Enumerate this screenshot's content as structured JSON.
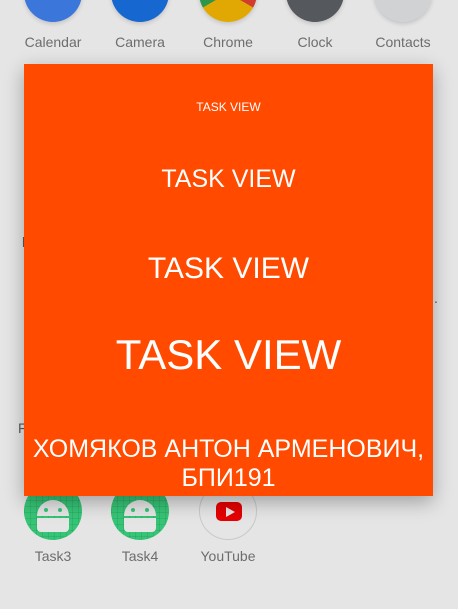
{
  "launcher": {
    "top_row": [
      {
        "label": "Calendar",
        "icon": "calendar-icon",
        "color": "#4285f4"
      },
      {
        "label": "Camera",
        "icon": "camera-icon",
        "color": "#1a73e8"
      },
      {
        "label": "Chrome",
        "icon": "chrome-icon",
        "color": "#fbbc04"
      },
      {
        "label": "Clock",
        "icon": "clock-icon",
        "color": "#5f6368"
      },
      {
        "label": "Contacts",
        "icon": "contacts-icon",
        "color": "#e8eaed"
      }
    ],
    "bottom_row": [
      {
        "label": "Task3",
        "icon": "android-icon",
        "color": "#3ddc84"
      },
      {
        "label": "Task4",
        "icon": "android-icon",
        "color": "#3ddc84"
      },
      {
        "label": "YouTube",
        "icon": "youtube-icon",
        "color": "#ff0000"
      }
    ],
    "fragments": [
      "l",
      "F",
      "."
    ]
  },
  "dialog": {
    "background": "#ff4a00",
    "lines": [
      "TASK VIEW",
      "TASK VIEW",
      "TASK VIEW",
      "TASK VIEW"
    ],
    "author": "ХОМЯКОВ АНТОН АРМЕНОВИЧ, БПИ191"
  }
}
